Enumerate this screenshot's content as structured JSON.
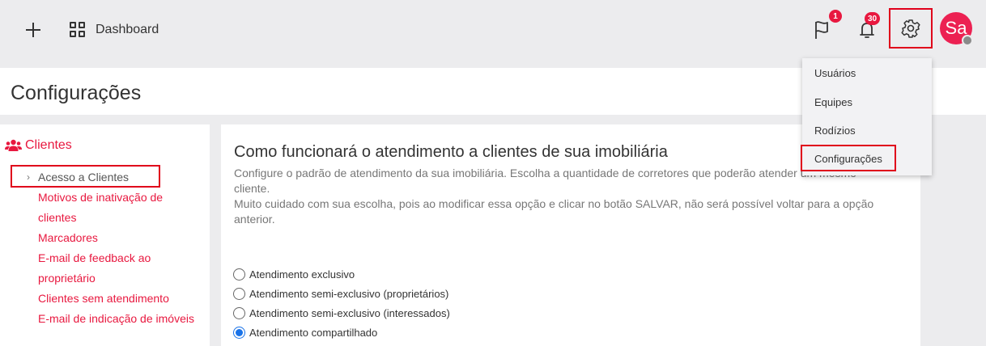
{
  "topbar": {
    "dashboard_label": "Dashboard",
    "flag_badge": "1",
    "bell_badge": "30",
    "avatar_initials": "Sa"
  },
  "page": {
    "title": "Configurações"
  },
  "sidebar": {
    "section_label": "Clientes",
    "active_item": "Acesso a Clientes",
    "items": [
      "Motivos de inativação de",
      "clientes",
      "Marcadores",
      "E-mail de feedback ao",
      "proprietário",
      "Clientes sem atendimento",
      "E-mail de indicação de imóveis"
    ]
  },
  "main": {
    "title": "Como funcionará o atendimento a clientes de sua imobiliária",
    "desc_line1": "Configure o padrão de atendimento da sua imobiliária. Escolha a quantidade de corretores que poderão atender um mesmo",
    "desc_line2": "cliente.",
    "desc_line3": "Muito cuidado com sua escolha, pois ao modificar essa opção e clicar no botão SALVAR, não será possível voltar para a opção",
    "desc_line4": "anterior.",
    "options": [
      {
        "label": "Atendimento exclusivo",
        "selected": false
      },
      {
        "label": "Atendimento semi-exclusivo (proprietários)",
        "selected": false
      },
      {
        "label": "Atendimento semi-exclusivo (interessados)",
        "selected": false
      },
      {
        "label": "Atendimento compartilhado",
        "selected": true
      }
    ]
  },
  "dropdown": {
    "items": [
      "Usuários",
      "Equipes",
      "Rodízios"
    ],
    "active_item": "Configurações"
  },
  "colors": {
    "accent": "#e8183f",
    "highlight_border": "#e0001b",
    "radio_selected": "#1a73e8"
  }
}
